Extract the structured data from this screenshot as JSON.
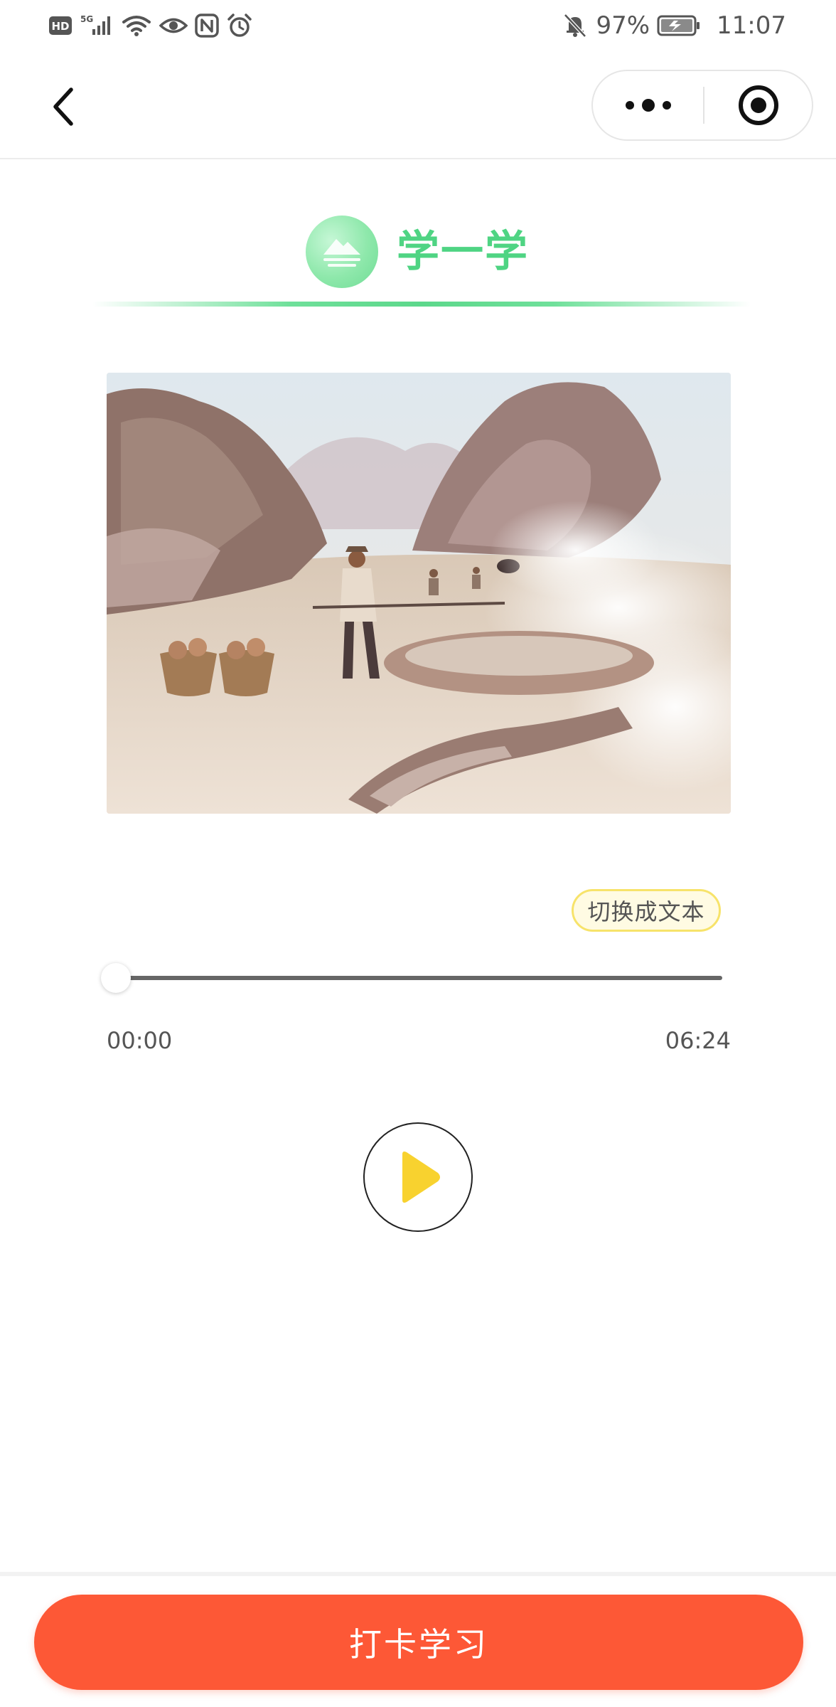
{
  "status_bar": {
    "icons": [
      "hd-icon",
      "5g-signal-icon",
      "wifi-icon",
      "eye-icon",
      "nfc-icon",
      "alarm-icon"
    ],
    "mute_icon": "bell-off-icon",
    "battery_percent": "97%",
    "battery_icon": "battery-charging-icon",
    "time": "11:07"
  },
  "nav_bar": {
    "back_icon": "chevron-left-icon",
    "more_icon": "more-dots-icon",
    "close_icon": "target-close-icon"
  },
  "section": {
    "title": "学一学",
    "icon": "mountain-icon",
    "accent_color": "#4fd483"
  },
  "lesson_image": {
    "icon": "watercolor-illustration"
  },
  "player": {
    "switch_label": "切换成文本",
    "current_time": "00:00",
    "total_time": "06:24",
    "progress": 0,
    "play_icon": "play-icon",
    "play_color": "#f8d22f"
  },
  "actions": {
    "checkin_label": "打卡学习",
    "checkin_color": "#fd5836"
  }
}
